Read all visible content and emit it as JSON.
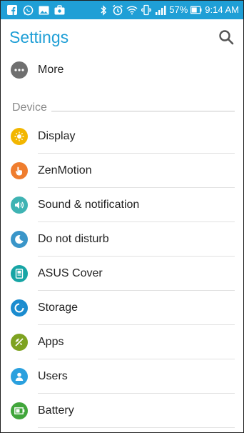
{
  "status_bar": {
    "battery_percent": "57%",
    "time": "9:14 AM",
    "notification_icons": [
      "facebook-icon",
      "whatsapp-icon",
      "gallery-icon",
      "briefcase-icon"
    ],
    "system_icons": [
      "bluetooth-icon",
      "alarm-icon",
      "wifi-icon",
      "vibrate-icon",
      "signal-icon",
      "battery-icon"
    ],
    "background_color": "#1f9fd6"
  },
  "header": {
    "title": "Settings",
    "title_color": "#1f9fd6",
    "search_icon": "search-icon"
  },
  "more": {
    "label": "More",
    "icon": "more-icon",
    "color": "#6f6f6f"
  },
  "device_section": {
    "label": "Device",
    "items": [
      {
        "label": "Display",
        "icon": "display-icon",
        "color": "#f2b600"
      },
      {
        "label": "ZenMotion",
        "icon": "zenmotion-icon",
        "color": "#ef7d2e"
      },
      {
        "label": "Sound & notification",
        "icon": "sound-icon",
        "color": "#3fb3b3"
      },
      {
        "label": "Do not disturb",
        "icon": "do-not-disturb-icon",
        "color": "#3a96c9"
      },
      {
        "label": "ASUS Cover",
        "icon": "asus-cover-icon",
        "color": "#17a5a5"
      },
      {
        "label": "Storage",
        "icon": "storage-icon",
        "color": "#1b8ccf"
      },
      {
        "label": "Apps",
        "icon": "apps-icon",
        "color": "#7ea321"
      },
      {
        "label": "Users",
        "icon": "users-icon",
        "color": "#2aa0de"
      },
      {
        "label": "Battery",
        "icon": "battery-icon",
        "color": "#41a63b"
      }
    ]
  }
}
